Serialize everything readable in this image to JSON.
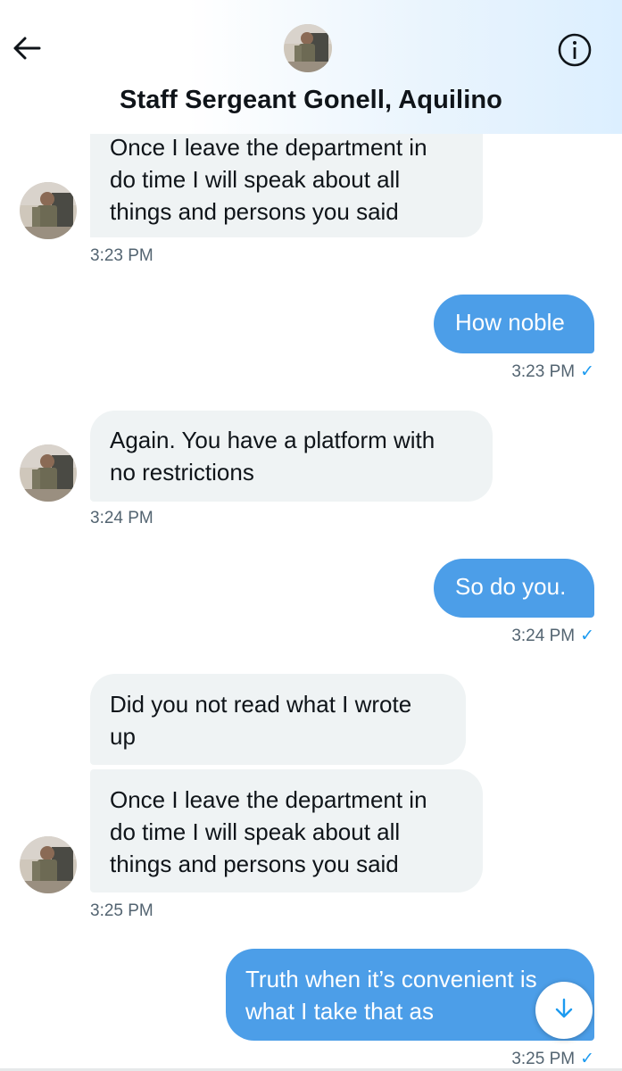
{
  "header": {
    "back_icon": "arrow-left-icon",
    "info_icon": "info-circle-icon",
    "title": "Staff Sergeant Gonell, Aquilino"
  },
  "messages": [
    {
      "direction": "in",
      "text": [
        "Once I leave the department in",
        "do time I will speak about all",
        "things and persons you said"
      ],
      "time": "3:23 PM"
    },
    {
      "direction": "out",
      "text": [
        "How noble"
      ],
      "time": "3:23 PM"
    },
    {
      "direction": "in",
      "text": [
        "Again. You have a platform with",
        "no restrictions"
      ],
      "time": "3:24 PM"
    },
    {
      "direction": "out",
      "text": [
        "So do you."
      ],
      "time": "3:24 PM"
    },
    {
      "direction": "in",
      "text": [
        "Did you not read what I wrote",
        "up"
      ]
    },
    {
      "direction": "in",
      "text": [
        "Once I leave the department in",
        "do time I will speak about all",
        "things and persons you said"
      ],
      "time": "3:25 PM"
    },
    {
      "direction": "out",
      "text": [
        "Truth when it’s convenient is",
        "what I take that as"
      ],
      "time": "3:25 PM"
    }
  ],
  "read_check": "✓",
  "scroll_icon": "arrow-down-icon",
  "colors": {
    "outgoing_bubble": "#4c9ee8",
    "incoming_bubble": "#eff3f4",
    "accent": "#1d9bf0"
  }
}
